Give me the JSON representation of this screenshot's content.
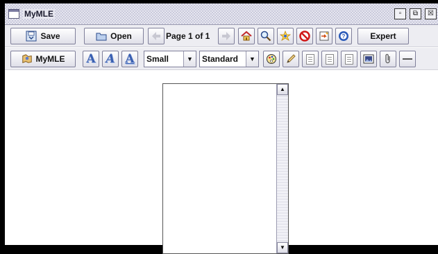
{
  "window": {
    "title": "MyMLE",
    "controls": {
      "minimize": "▫",
      "maximize": "⧉",
      "close": "☒"
    }
  },
  "toolbar1": {
    "save_label": "Save",
    "open_label": "Open",
    "page_indicator": "Page 1 of 1",
    "expert_label": "Expert",
    "icons": [
      "back-arrow-icon",
      "forward-arrow-icon",
      "home-icon",
      "search-icon",
      "highlight-icon",
      "stop-icon",
      "import-icon",
      "help-icon"
    ]
  },
  "toolbar2": {
    "mymle_label": "MyMLE",
    "font_size": "Small",
    "style": "Standard",
    "icons": [
      "text-style-a-icon",
      "italic-a-icon",
      "underline-a-icon",
      "palette-icon",
      "pencil-icon",
      "align-left-icon",
      "align-center-icon",
      "align-right-icon",
      "image-icon",
      "attach-icon",
      "horizontal-rule-icon"
    ]
  },
  "editor": {
    "text": ""
  }
}
